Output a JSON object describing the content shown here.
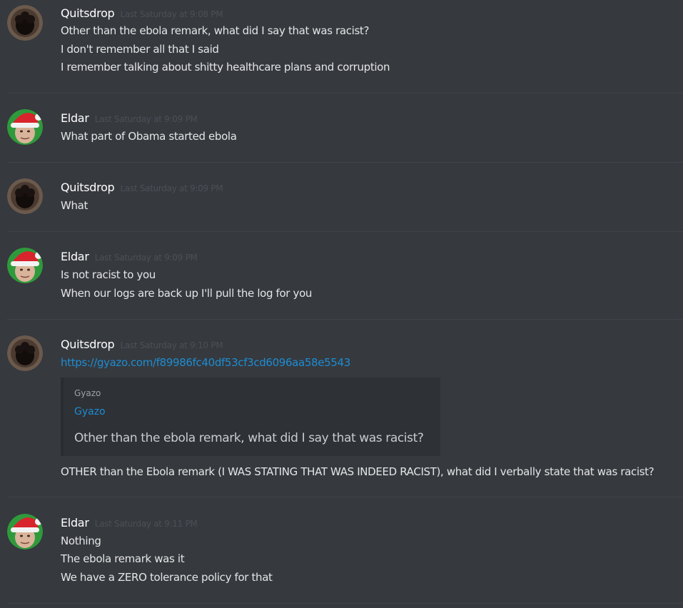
{
  "messages": [
    {
      "user": "Quitsdrop",
      "avatar": "paw-avatar",
      "time": "Last Saturday at 9:08 PM",
      "lines": [
        "Other than the ebola remark, what did I say that was racist?",
        "I don't remember all that I said",
        "I remember talking about shitty healthcare plans and corruption"
      ]
    },
    {
      "user": "Eldar",
      "avatar": "santa-hat-avatar",
      "time": "Last Saturday at 9:09 PM",
      "lines": [
        "What part of Obama started ebola"
      ]
    },
    {
      "user": "Quitsdrop",
      "avatar": "paw-avatar",
      "time": "Last Saturday at 9:09 PM",
      "lines": [
        "What"
      ]
    },
    {
      "user": "Eldar",
      "avatar": "santa-hat-avatar",
      "time": "Last Saturday at 9:09 PM",
      "lines": [
        "Is not racist to you",
        "When our logs are back up I'll pull the log for you"
      ]
    },
    {
      "user": "Quitsdrop",
      "avatar": "paw-avatar",
      "time": "Last Saturday at 9:10 PM",
      "link": "https://gyazo.com/f89986fc40df53cf3cd6096aa58e5543",
      "embed": {
        "provider": "Gyazo",
        "title": "Gyazo",
        "description": "Other than the ebola remark, what did I say that was racist?"
      },
      "lines": [
        "OTHER than the Ebola remark (I WAS STATING THAT WAS INDEED RACIST), what did I verbally state that was racist?"
      ]
    },
    {
      "user": "Eldar",
      "avatar": "santa-hat-avatar",
      "time": "Last Saturday at 9:11 PM",
      "lines": [
        "Nothing",
        "The ebola remark was it",
        "We have a ZERO tolerance policy for that"
      ]
    }
  ],
  "colors": {
    "background": "#36393e",
    "divider": "#40444a",
    "username": "#ffffff",
    "timestamp": "#4c5057",
    "message_text": "#e4e5e6",
    "link": "#1d8dd2",
    "embed_bg": "#2e3136"
  }
}
